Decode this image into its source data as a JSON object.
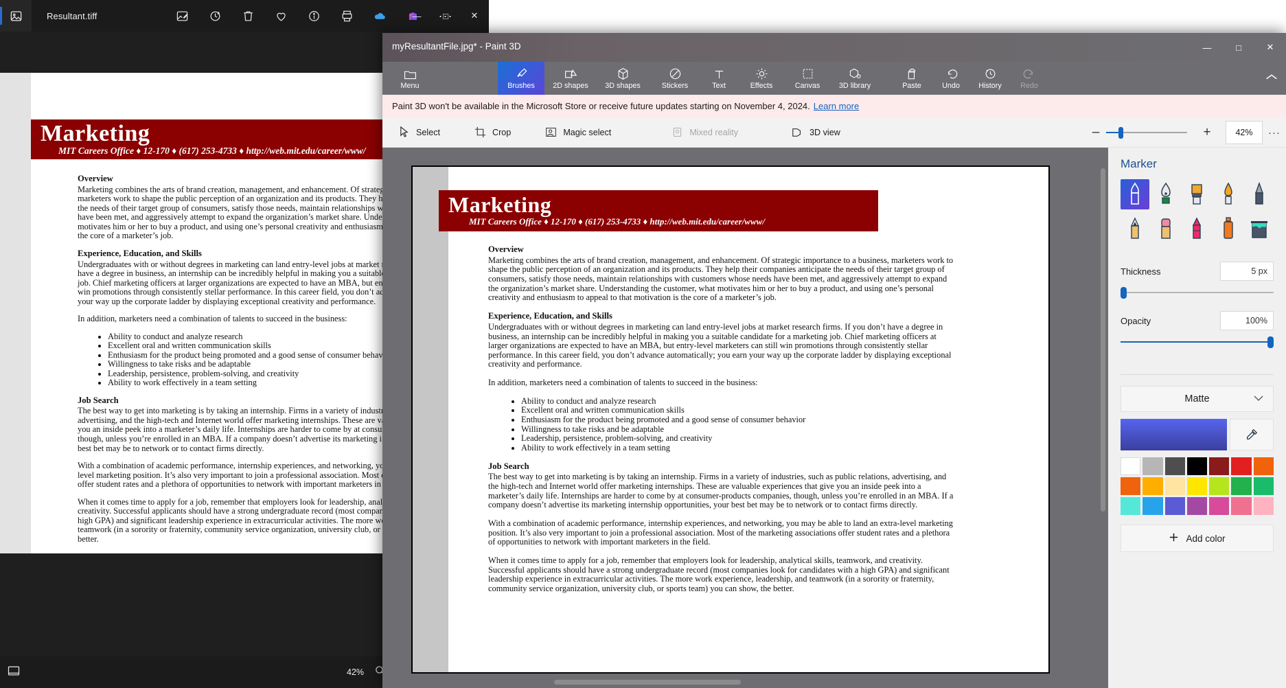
{
  "photos": {
    "title": "Resultant.tiff",
    "app_icon": "image-icon",
    "toolbar": [
      {
        "name": "edit-image-icon",
        "label": "Edit image"
      },
      {
        "name": "rotate-icon",
        "label": "Rotate"
      },
      {
        "name": "delete-icon",
        "label": "Delete"
      },
      {
        "name": "favorite-icon",
        "label": "Add to favorites"
      },
      {
        "name": "info-icon",
        "label": "File info"
      },
      {
        "name": "print-icon",
        "label": "Print"
      },
      {
        "name": "onedrive-icon",
        "label": "OneDrive"
      },
      {
        "name": "designer-icon",
        "label": "Designer"
      },
      {
        "name": "more-options-icon",
        "label": "See more"
      }
    ],
    "window_controls": {
      "minimize": "—",
      "maximize": "□",
      "close": "✕"
    },
    "zoom_level": "42%",
    "bottom_left_icon": "fit-to-window-icon",
    "magnifier_icon": "magnifier-icon"
  },
  "document": {
    "banner_title": "Marketing",
    "banner_subtitle": "MIT Careers Office ♦ 12-170 ♦ (617) 253-4733 ♦ http://web.mit.edu/career/www/",
    "sections": [
      {
        "heading": "Overview",
        "paragraphs": [
          "Marketing combines the arts of brand creation, management, and enhancement.  Of strategic importance to a business, marketers work to shape the public perception of an organization and its products.  They help their companies anticipate the needs of their target group of consumers, satisfy those needs, maintain relationships with customers whose needs have been met, and aggressively attempt to expand the organization’s market share.  Understanding the customer, what motivates him or her to buy a product, and using one’s personal creativity and enthusiasm to appeal to that motivation is the core of a marketer’s job."
        ]
      },
      {
        "heading": "Experience, Education, and Skills",
        "paragraphs": [
          "Undergraduates with or without degrees in marketing can land entry-level jobs at market research firms.  If you don’t have a degree in business, an internship can be incredibly helpful in making you a suitable candidate for a marketing job.  Chief marketing officers at larger organizations are expected to have an MBA, but entry-level marketers can still win promotions through consistently stellar performance.  In this career field, you don’t advance automatically; you earn your way up the corporate ladder by displaying exceptional creativity and performance.",
          "In addition, marketers need a combination of talents to succeed in the business:"
        ],
        "bullets": [
          "Ability to conduct and analyze research",
          "Excellent oral and written communication skills",
          "Enthusiasm for the product being promoted and a good sense of consumer behavior",
          "Willingness to take risks and be adaptable",
          "Leadership, persistence, problem-solving, and creativity",
          "Ability to work effectively in a team setting"
        ]
      },
      {
        "heading": "Job Search",
        "paragraphs": [
          "The best way to get into marketing is by taking an internship.  Firms in a variety of industries, such as public relations, advertising, and the high-tech and Internet world offer marketing internships.  These are valuable experiences that give you an inside peek into a marketer’s daily life.  Internships are harder to come by at consumer-products companies, though, unless you’re enrolled in an MBA.  If a company doesn’t advertise its marketing internship opportunities, your best bet may be to network or to contact firms directly.",
          "With a combination of academic performance, internship experiences, and networking, you may be able to land an extra-level marketing position.  It’s also very important to join a professional association.  Most of the marketing associations offer student rates and a plethora of opportunities to network with important marketers in the field.",
          "When it comes time to apply for a job, remember that employers look for leadership, analytical skills, teamwork, and creativity.  Successful applicants should have a strong undergraduate record (most companies look for candidates with a high GPA) and significant leadership experience in extracurricular activities.  The more work experience, leadership, and teamwork (in a sorority or fraternity, community service organization, university club, or sports team) you can show, the better."
        ]
      }
    ]
  },
  "paint3d": {
    "title": "myResultantFile.jpg* - Paint 3D",
    "window_controls": {
      "minimize": "—",
      "maximize": "□",
      "close": "✕"
    },
    "ribbon": [
      {
        "label": "Menu",
        "icon": "folder-icon",
        "state": "normal"
      },
      {
        "label": "Brushes",
        "icon": "brush-icon",
        "state": "active"
      },
      {
        "label": "2D shapes",
        "icon": "2d-shapes-icon",
        "state": "normal"
      },
      {
        "label": "3D shapes",
        "icon": "3d-shapes-icon",
        "state": "normal"
      },
      {
        "label": "Stickers",
        "icon": "stickers-icon",
        "state": "normal"
      },
      {
        "label": "Text",
        "icon": "text-icon",
        "state": "normal"
      },
      {
        "label": "Effects",
        "icon": "effects-icon",
        "state": "normal"
      },
      {
        "label": "Canvas",
        "icon": "canvas-icon",
        "state": "normal"
      },
      {
        "label": "3D library",
        "icon": "3d-library-icon",
        "state": "normal"
      },
      {
        "label": "Paste",
        "icon": "paste-icon",
        "state": "normal"
      },
      {
        "label": "Undo",
        "icon": "undo-icon",
        "state": "normal"
      },
      {
        "label": "History",
        "icon": "history-icon",
        "state": "normal"
      },
      {
        "label": "Redo",
        "icon": "redo-icon",
        "state": "disabled"
      }
    ],
    "collapse_icon": "chevron-up-icon",
    "banner": {
      "message": "Paint 3D won't be available in the Microsoft Store or receive future updates starting on November 4, 2024.",
      "link": "Learn more"
    },
    "subbar": [
      {
        "label": "Select",
        "icon": "cursor-select-icon",
        "state": "normal"
      },
      {
        "label": "Crop",
        "icon": "crop-icon",
        "state": "normal"
      },
      {
        "label": "Magic select",
        "icon": "magic-select-icon",
        "state": "normal"
      },
      {
        "label": "Mixed reality",
        "icon": "mixed-reality-icon",
        "state": "disabled"
      },
      {
        "label": "3D view",
        "icon": "3d-view-icon",
        "state": "normal"
      }
    ],
    "zoom": {
      "minus": "–",
      "plus": "+",
      "value": "42%",
      "more": "···"
    },
    "panel": {
      "title": "Marker",
      "brushes": [
        {
          "name": "marker-brush",
          "selected": true
        },
        {
          "name": "calligraphy-pen-brush",
          "selected": false
        },
        {
          "name": "oil-brush",
          "selected": false
        },
        {
          "name": "watercolor-brush",
          "selected": false
        },
        {
          "name": "pixel-pen-brush",
          "selected": false
        },
        {
          "name": "pencil-brush",
          "selected": false
        },
        {
          "name": "eraser-brush",
          "selected": false
        },
        {
          "name": "crayon-brush",
          "selected": false
        },
        {
          "name": "spray-can-brush",
          "selected": false
        },
        {
          "name": "fill-bucket-brush",
          "selected": false
        }
      ],
      "thickness": {
        "label": "Thickness",
        "value": "5 px",
        "percent": 4
      },
      "opacity": {
        "label": "Opacity",
        "value": "100%",
        "percent": 100
      },
      "material": {
        "label": "Matte",
        "chevron": "⌄"
      },
      "current_color": "#4a55e0",
      "eyedropper_icon": "eyedropper-icon",
      "swatches": [
        [
          "#ffffff",
          "#b6b6b6",
          "#4e4e4e",
          "#000000",
          "#8b1a1a",
          "#e32020",
          "#f0620c"
        ],
        [
          "#f0620c",
          "#ffae00",
          "#ffe3a0",
          "#ffe600",
          "#b5e61d",
          "#22b14c",
          "#1abc6b"
        ],
        [
          "#55e8d8",
          "#26a3ea",
          "#5b5bd6",
          "#a349a4",
          "#d84a9a",
          "#f07090",
          "#ffb3c1"
        ]
      ],
      "add_color": {
        "label": "Add color",
        "icon": "plus-icon"
      }
    }
  }
}
